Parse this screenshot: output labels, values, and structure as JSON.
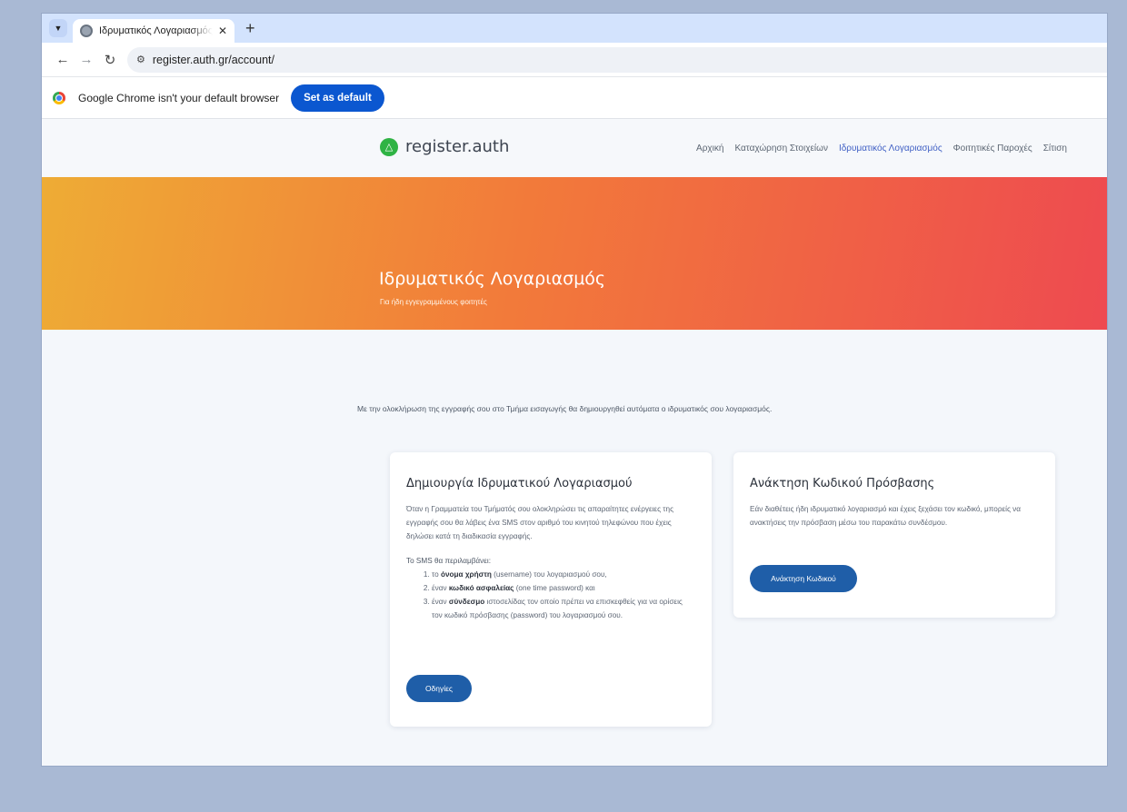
{
  "browser": {
    "tab": {
      "title": "Ιδρυματικός Λογαριασμός – Σύ"
    },
    "address": "register.auth.gr/account/",
    "infobar": {
      "message": "Google Chrome isn't your default browser",
      "button": "Set as default"
    }
  },
  "site": {
    "brand": "register.auth",
    "nav": [
      {
        "label": "Αρχική"
      },
      {
        "label": "Καταχώρηση Στοιχείων"
      },
      {
        "label": "Ιδρυματικός Λογαριασμός"
      },
      {
        "label": "Φοιτητικές Παροχές"
      },
      {
        "label": "Σίτιση"
      }
    ],
    "active_nav": "Ιδρυματικός Λογαριασμός"
  },
  "hero": {
    "title": "Ιδρυματικός Λογαριασμός",
    "subtitle": "Για ήδη εγγεγραμμένους φοιτητές"
  },
  "intro": "Με την ολοκλήρωση της εγγραφής σου στο Τμήμα εισαγωγής θα δημιουργηθεί αυτόματα ο ιδρυματικός σου λογαριασμός.",
  "cards": {
    "create": {
      "title": "Δημιουργία Ιδρυματικού Λογαριασμού",
      "body": "Όταν η Γραμματεία του Τμήματός σου ολοκληρώσει τις απαραίτητες ενέργειες της εγγραφής σου θα λάβεις ένα SMS στον αριθμό του κινητού τηλεφώνου που έχεις δηλώσει κατά τη διαδικασία εγγραφής.",
      "sms_heading": "Το SMS θα περιλαμβάνει:",
      "items": [
        {
          "pre": "το ",
          "bold": "όνομα χρήστη",
          "post": " (username) του λογαριασμού σου,"
        },
        {
          "pre": "έναν ",
          "bold": "κωδικό ασφαλείας",
          "post": " (one time password) και"
        },
        {
          "pre": "έναν ",
          "bold": "σύνδεσμο",
          "post": " ιστοσελίδας τον οποίο πρέπει να επισκεφθείς για να ορίσεις τον κωδικό πρόσβασης (password) του λογαριασμού σου."
        }
      ],
      "button": "Οδηγίες"
    },
    "recover": {
      "title": "Ανάκτηση Κωδικού Πρόσβασης",
      "body": "Εάν διαθέτεις ήδη ιδρυματικό λογαριασμό και έχεις ξεχάσει τον κωδικό, μπορείς να ανακτήσεις την πρόσβαση μέσω του παρακάτω συνδέσμου.",
      "button": "Ανάκτηση Κωδικού"
    }
  },
  "colors": {
    "primary_button": "#1f5ea8",
    "chrome_button": "#0b57d0",
    "brand_icon": "#2fb344",
    "active_nav": "#3f5fc4"
  },
  "icons": {
    "tab_search": "chevron-down-icon",
    "favicon": "site-favicon",
    "brand": "bell-shaped logo"
  }
}
